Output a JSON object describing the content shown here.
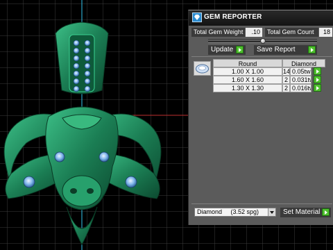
{
  "panel": {
    "title": "GEM REPORTER",
    "total_weight_label": "Total Gem Weight",
    "total_weight_value": ".10",
    "total_count_label": "Total Gem Count",
    "total_count_value": "18",
    "update_label": "Update",
    "save_report_label": "Save Report",
    "table": {
      "headers": [
        "Round",
        "Diamond"
      ],
      "rows": [
        {
          "size": "1.00 X 1.00",
          "count": "14",
          "weight": "0.05tw"
        },
        {
          "size": "1.60 X 1.60",
          "count": "2",
          "weight": "0.031tw"
        },
        {
          "size": "1.30 X 1.30",
          "count": "2",
          "weight": "0.016tw"
        }
      ]
    },
    "material_value": "Diamond     (3.52 spg)",
    "set_material_label": "Set Material"
  },
  "colors": {
    "viewport_bg": "#000000",
    "grid": "#3a3a3a",
    "model_green": "#1f8a5c",
    "gem_blue": "#5aa0e6",
    "panel_bg": "#5b5b5b",
    "accent_green": "#4fbf2e"
  },
  "icons": {
    "title": "gem-reporter-icon",
    "play": "play-arrow-icon",
    "gem": "round-gem-icon",
    "dropdown": "chevron-down-icon"
  }
}
